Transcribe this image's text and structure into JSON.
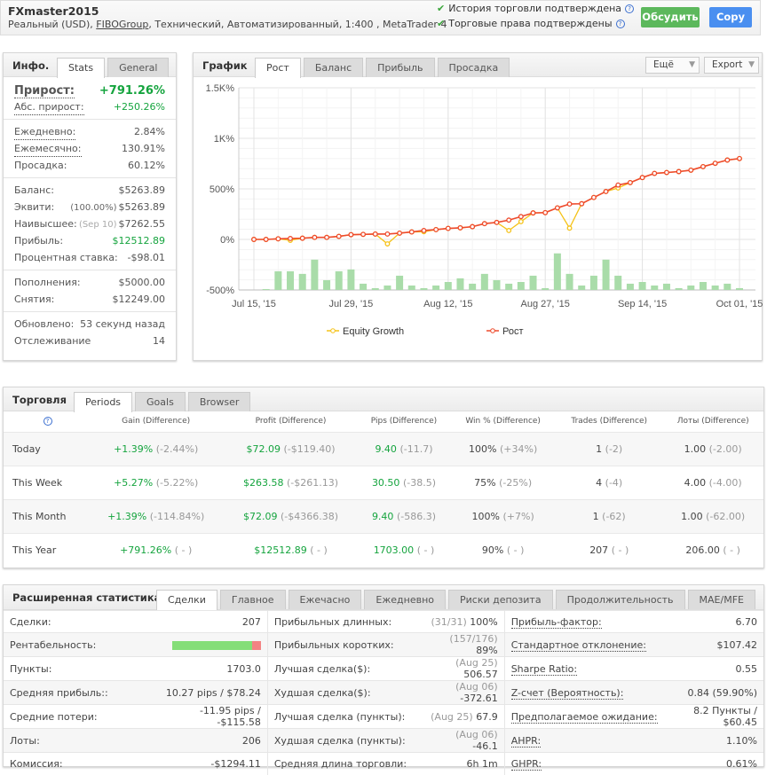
{
  "header": {
    "name": "FXmaster2015",
    "sub_prefix": "Реальный (USD), ",
    "broker": "FIBOGroup",
    "sub_suffix": ", Технический, Автоматизированный, 1:400 , MetaTrader 4",
    "verified": [
      "История торговли подтверждена",
      "Торговые права подтверждены"
    ],
    "discuss_label": "Обсудить",
    "copy_label": "Copy",
    "colors": {
      "discuss": "#5cb85c",
      "copy": "#4a8ff0",
      "check": "#3ca63c"
    }
  },
  "info": {
    "title": "Инфо.",
    "tabs": [
      "Stats",
      "General"
    ],
    "gain_label": "Прирост:",
    "gain_value": "+791.26%",
    "groups": [
      [
        {
          "label": "Абс. прирост:",
          "value": "+250.26%",
          "green": true,
          "dotted": true
        }
      ],
      [
        {
          "label": "Ежедневно:",
          "value": "2.84%",
          "dotted": true
        },
        {
          "label": "Ежемесячно:",
          "value": "130.91%",
          "dotted": true
        },
        {
          "label": "Просадка:",
          "value": "60.12%"
        }
      ],
      [
        {
          "label": "Баланс:",
          "value": "$5263.89"
        },
        {
          "label": "Эквити:",
          "note": "(100.00%)",
          "value": "$5263.89"
        },
        {
          "label": "Наивысшее:",
          "note": "(Sep 10)",
          "value": "$7262.55"
        },
        {
          "label": "Прибыль:",
          "value": "$12512.89",
          "green": true
        },
        {
          "label": "Процентная ставка:",
          "value": "-$98.01"
        }
      ],
      [
        {
          "label": "Пополнения:",
          "value": "$5000.00"
        },
        {
          "label": "Снятия:",
          "value": "$12249.00"
        }
      ],
      [
        {
          "label": "Обновлено:",
          "value": "53 секунд назад"
        },
        {
          "label": "Отслеживание",
          "value": "14"
        }
      ]
    ]
  },
  "chart": {
    "title": "График",
    "tabs": [
      "Рост",
      "Баланс",
      "Прибыль",
      "Просадка"
    ],
    "more_label": "Ещё",
    "export_label": "Export"
  },
  "chart_data": {
    "type": "line",
    "y_ticks": [
      "-500%",
      "0%",
      "500%",
      "1K%",
      "1.5K%"
    ],
    "ylim": [
      -500,
      1500
    ],
    "x_ticks": [
      {
        "index": 0,
        "label": "Jul 15, '15"
      },
      {
        "index": 8,
        "label": "Jul 29, '15"
      },
      {
        "index": 16,
        "label": "Aug 12, '15"
      },
      {
        "index": 24,
        "label": "Aug 27, '15"
      },
      {
        "index": 32,
        "label": "Sep 14, '15"
      },
      {
        "index": 40,
        "label": "Oct 01, '15"
      }
    ],
    "grid": true,
    "legend": "bottom",
    "series": [
      {
        "name": "Equity Growth",
        "color": "#f5c218",
        "values": [
          0,
          0,
          6,
          -9,
          12,
          20,
          20,
          30,
          47,
          50,
          53,
          -44,
          62,
          74,
          76,
          97,
          109,
          115,
          126,
          156,
          168,
          88,
          176,
          262,
          265,
          312,
          112,
          353,
          415,
          474,
          509,
          562,
          612,
          653,
          662,
          671,
          685,
          720,
          753,
          785,
          800
        ]
      },
      {
        "name": "Рост",
        "color": "#ee4a2c",
        "values": [
          0,
          0,
          6,
          9,
          12,
          20,
          20,
          30,
          47,
          50,
          53,
          53,
          62,
          74,
          88,
          97,
          109,
          115,
          126,
          156,
          168,
          191,
          226,
          262,
          265,
          312,
          350,
          353,
          415,
          474,
          538,
          562,
          612,
          653,
          662,
          671,
          685,
          720,
          753,
          785,
          800
        ]
      }
    ],
    "bars": {
      "color": "#a9dca9",
      "values": [
        -500,
        -491,
        -315,
        -315,
        -341,
        -200,
        -403,
        -315,
        -297,
        -438,
        -482,
        -456,
        -359,
        -456,
        -482,
        -456,
        -421,
        -385,
        -438,
        -341,
        -403,
        -438,
        -421,
        -359,
        -482,
        -138,
        -341,
        -456,
        -359,
        -200,
        -359,
        -438,
        -421,
        -456,
        -438,
        -482,
        -456,
        -421,
        -456,
        -438,
        -482
      ]
    }
  },
  "trading": {
    "title": "Торговля",
    "tabs": [
      "Periods",
      "Goals",
      "Browser"
    ],
    "columns": [
      "Gain (Difference)",
      "Profit (Difference)",
      "Pips (Difference)",
      "Win % (Difference)",
      "Trades (Difference)",
      "Лоты (Difference)"
    ],
    "rows": [
      {
        "period": "Today",
        "cells": [
          [
            "+1.39%",
            "(-2.44%)"
          ],
          [
            "$72.09",
            "(-$119.40)"
          ],
          [
            "9.40",
            "(-11.7)"
          ],
          [
            "100%",
            "(+34%)"
          ],
          [
            "1",
            "(-2)"
          ],
          [
            "1.00",
            "(-2.00)"
          ]
        ]
      },
      {
        "period": "This Week",
        "cells": [
          [
            "+5.27%",
            "(-5.22%)"
          ],
          [
            "$263.58",
            "(-$261.13)"
          ],
          [
            "30.50",
            "(-38.5)"
          ],
          [
            "75%",
            "(-25%)"
          ],
          [
            "4",
            "(-4)"
          ],
          [
            "4.00",
            "(-4.00)"
          ]
        ]
      },
      {
        "period": "This Month",
        "cells": [
          [
            "+1.39%",
            "(-114.84%)"
          ],
          [
            "$72.09",
            "(-$4366.38)"
          ],
          [
            "9.40",
            "(-586.3)"
          ],
          [
            "100%",
            "(+7%)"
          ],
          [
            "1",
            "(-62)"
          ],
          [
            "1.00",
            "(-62.00)"
          ]
        ]
      },
      {
        "period": "This Year",
        "cells": [
          [
            "+791.26%",
            "( - )"
          ],
          [
            "$12512.89",
            "( - )"
          ],
          [
            "1703.00",
            "( - )"
          ],
          [
            "90%",
            "( - )"
          ],
          [
            "207",
            "( - )"
          ],
          [
            "206.00",
            "( - )"
          ]
        ]
      }
    ]
  },
  "extended": {
    "title": "Расширенная статистика",
    "tabs": [
      "Сделки",
      "Главное",
      "Ежечасно",
      "Ежедневно",
      "Риски депозита",
      "Продолжительность",
      "MAE/MFE"
    ],
    "profitability": {
      "win_fraction": 0.9,
      "win_color": "#84de78",
      "loss_color": "#f38383"
    },
    "rows": [
      [
        {
          "label": "Сделки:",
          "value": "207"
        },
        {
          "label": "Прибыльных длинных:",
          "note": "(31/31)",
          "value": "100%"
        },
        {
          "label": "Прибыль-фактор:",
          "value": "6.70"
        }
      ],
      [
        {
          "label": "Рентабельность:",
          "bar": true
        },
        {
          "label": "Прибыльных коротких:",
          "note": "(157/176)",
          "value": "89%"
        },
        {
          "label": "Стандартное отклонение:",
          "value": "$107.42"
        }
      ],
      [
        {
          "label": "Пункты:",
          "value": "1703.0"
        },
        {
          "label": "Лучшая сделка($):",
          "note": "(Aug 25)",
          "value": "506.57"
        },
        {
          "label": "Sharpe Ratio:",
          "value": "0.55"
        }
      ],
      [
        {
          "label": "Средняя прибыль::",
          "value": "10.27 pips / $78.24"
        },
        {
          "label": "Худшая сделка($):",
          "note": "(Aug 06)",
          "value": "-372.61"
        },
        {
          "label": "Z-счет (Вероятность):",
          "value": "0.84 (59.90%)"
        }
      ],
      [
        {
          "label": "Средние потери:",
          "value": "-11.95 pips / -$115.58"
        },
        {
          "label": "Лучшая сделка (пункты):",
          "note": "(Aug 25)",
          "value": "67.9"
        },
        {
          "label": "Предполагаемое ожидание:",
          "value": "8.2 Пункты / $60.45"
        }
      ],
      [
        {
          "label": "Лоты:",
          "value": "206"
        },
        {
          "label": "Худшая сделка (пункты):",
          "note": "(Aug 06)",
          "value": "-46.1"
        },
        {
          "label": "AHPR:",
          "value": "1.10%"
        }
      ],
      [
        {
          "label": "Комиссия:",
          "value": "-$1294.11"
        },
        {
          "label": "Средняя длина торговли:",
          "value": "6h 1m"
        },
        {
          "label": "GHPR:",
          "value": "0.61%"
        }
      ]
    ]
  }
}
